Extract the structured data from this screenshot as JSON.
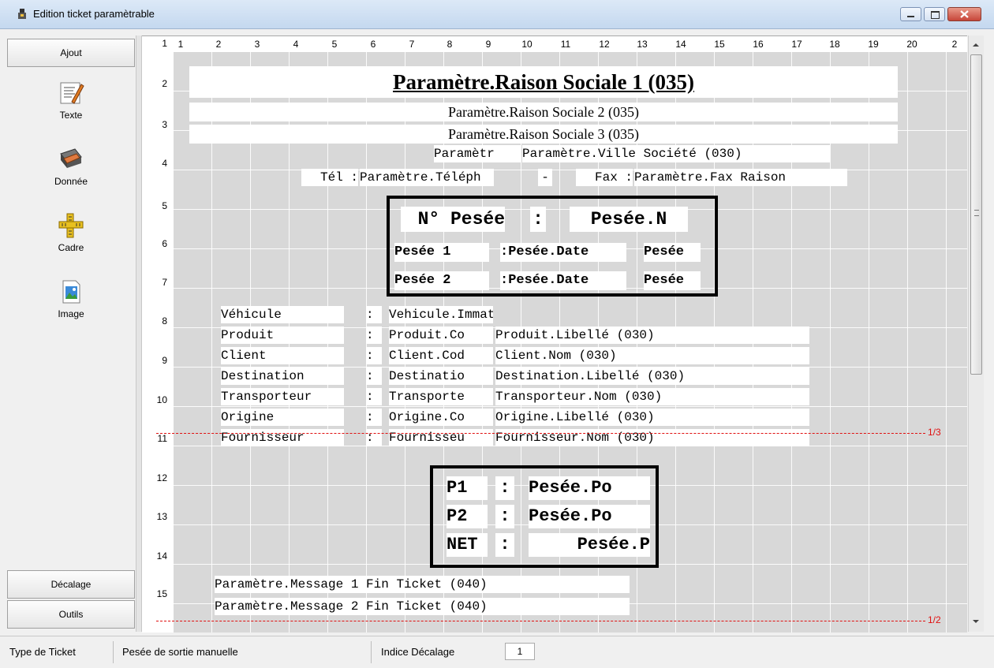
{
  "window": {
    "title": "Edition ticket paramètrable"
  },
  "sidebar": {
    "add_label": "Ajout",
    "tools": [
      {
        "label": "Texte",
        "icon": "text-icon"
      },
      {
        "label": "Donnée",
        "icon": "data-icon"
      },
      {
        "label": "Cadre",
        "icon": "frame-icon"
      },
      {
        "label": "Image",
        "icon": "image-icon"
      }
    ],
    "offset_label": "Décalage",
    "tools_label": "Outils"
  },
  "ruler": {
    "columns": [
      "1",
      "2",
      "3",
      "4",
      "5",
      "6",
      "7",
      "8",
      "9",
      "10",
      "11",
      "12",
      "13",
      "14",
      "15",
      "16",
      "17",
      "18",
      "19",
      "20",
      "2"
    ],
    "rows": [
      "1",
      "2",
      "3",
      "4",
      "5",
      "6",
      "7",
      "8",
      "9",
      "10",
      "11",
      "12",
      "13",
      "14",
      "15"
    ]
  },
  "ticket": {
    "header1": "Paramètre.Raison Sociale 1 (035)",
    "header2": "Paramètre.Raison Sociale 2 (035)",
    "header3": "Paramètre.Raison Sociale 3 (035)",
    "param_short": "Paramètr",
    "ville": "Paramètre.Ville Société (030)",
    "tel_label": "Tél :",
    "tel_value": "Paramètre.Téléph",
    "dash": "-",
    "fax_label": "Fax :",
    "fax_value": "Paramètre.Fax Raison",
    "weigh_no_label": "N° Pesée",
    "colon": ":",
    "weigh_no_value": "Pesée.N",
    "weigh1_label": "Pesée 1",
    "weigh1_date": ":Pesée.Date",
    "weigh1_extra": "Pesée",
    "weigh2_label": "Pesée 2",
    "weigh2_date": ":Pesée.Date",
    "weigh2_extra": "Pesée",
    "details": [
      {
        "label": "Véhicule",
        "colon": ":",
        "code": "Vehicule.Immatr",
        "name": ""
      },
      {
        "label": "Produit",
        "colon": ":",
        "code": "Produit.Co",
        "name": "Produit.Libellé (030)"
      },
      {
        "label": "Client",
        "colon": ":",
        "code": "Client.Cod",
        "name": "Client.Nom (030)"
      },
      {
        "label": "Destination",
        "colon": ":",
        "code": "Destinatio",
        "name": "Destination.Libellé (030)"
      },
      {
        "label": "Transporteur",
        "colon": ":",
        "code": "Transporte",
        "name": "Transporteur.Nom (030)"
      },
      {
        "label": "Origine",
        "colon": ":",
        "code": "Origine.Co",
        "name": "Origine.Libellé (030)"
      },
      {
        "label": "Fournisseur",
        "colon": ":",
        "code": "Fournisseu",
        "name": "Fournisseur.Nom (030)"
      }
    ],
    "weights": [
      {
        "label": "P1",
        "colon": ":",
        "value": "Pesée.Po"
      },
      {
        "label": "P2",
        "colon": ":",
        "value": "Pesée.Po"
      },
      {
        "label": "NET",
        "colon": ":",
        "value": "Pesée.P"
      }
    ],
    "footer1": "Paramètre.Message 1 Fin Ticket (040)",
    "footer2": "Paramètre.Message 2 Fin Ticket (040)",
    "marker_third": "1/3",
    "marker_half": "1/2"
  },
  "status": {
    "type_label": "Type de Ticket",
    "type_value": "Pesée de sortie manuelle",
    "offset_label": "Indice Décalage",
    "offset_value": "1"
  },
  "colors": {
    "marker": "#e01010",
    "grid": "#d8d8d8"
  }
}
